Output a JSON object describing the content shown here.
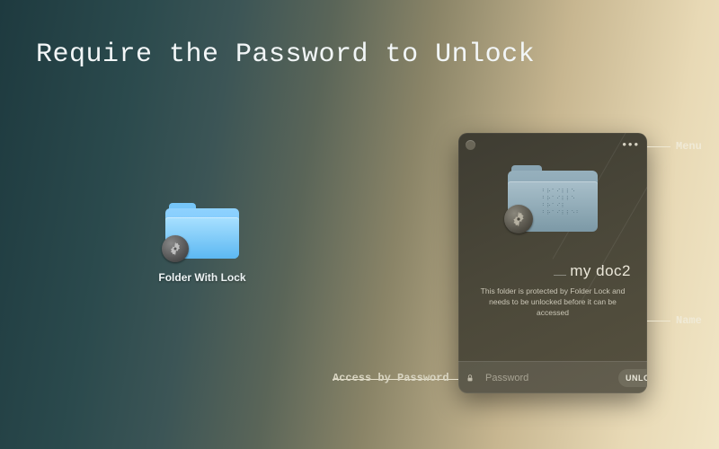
{
  "page_title": "Require the Password to Unlock",
  "left_icon": {
    "caption": "Folder With Lock"
  },
  "dialog": {
    "menu_glyph": "•••",
    "folder_name": "my doc2",
    "description": "This folder is protected by Folder Lock and needs to be unlocked before it can be accessed",
    "password_placeholder": "Password",
    "unlock_label": "UNLOCK"
  },
  "callouts": {
    "menu": "Menu",
    "name": "Name",
    "access": "Access by Password"
  }
}
